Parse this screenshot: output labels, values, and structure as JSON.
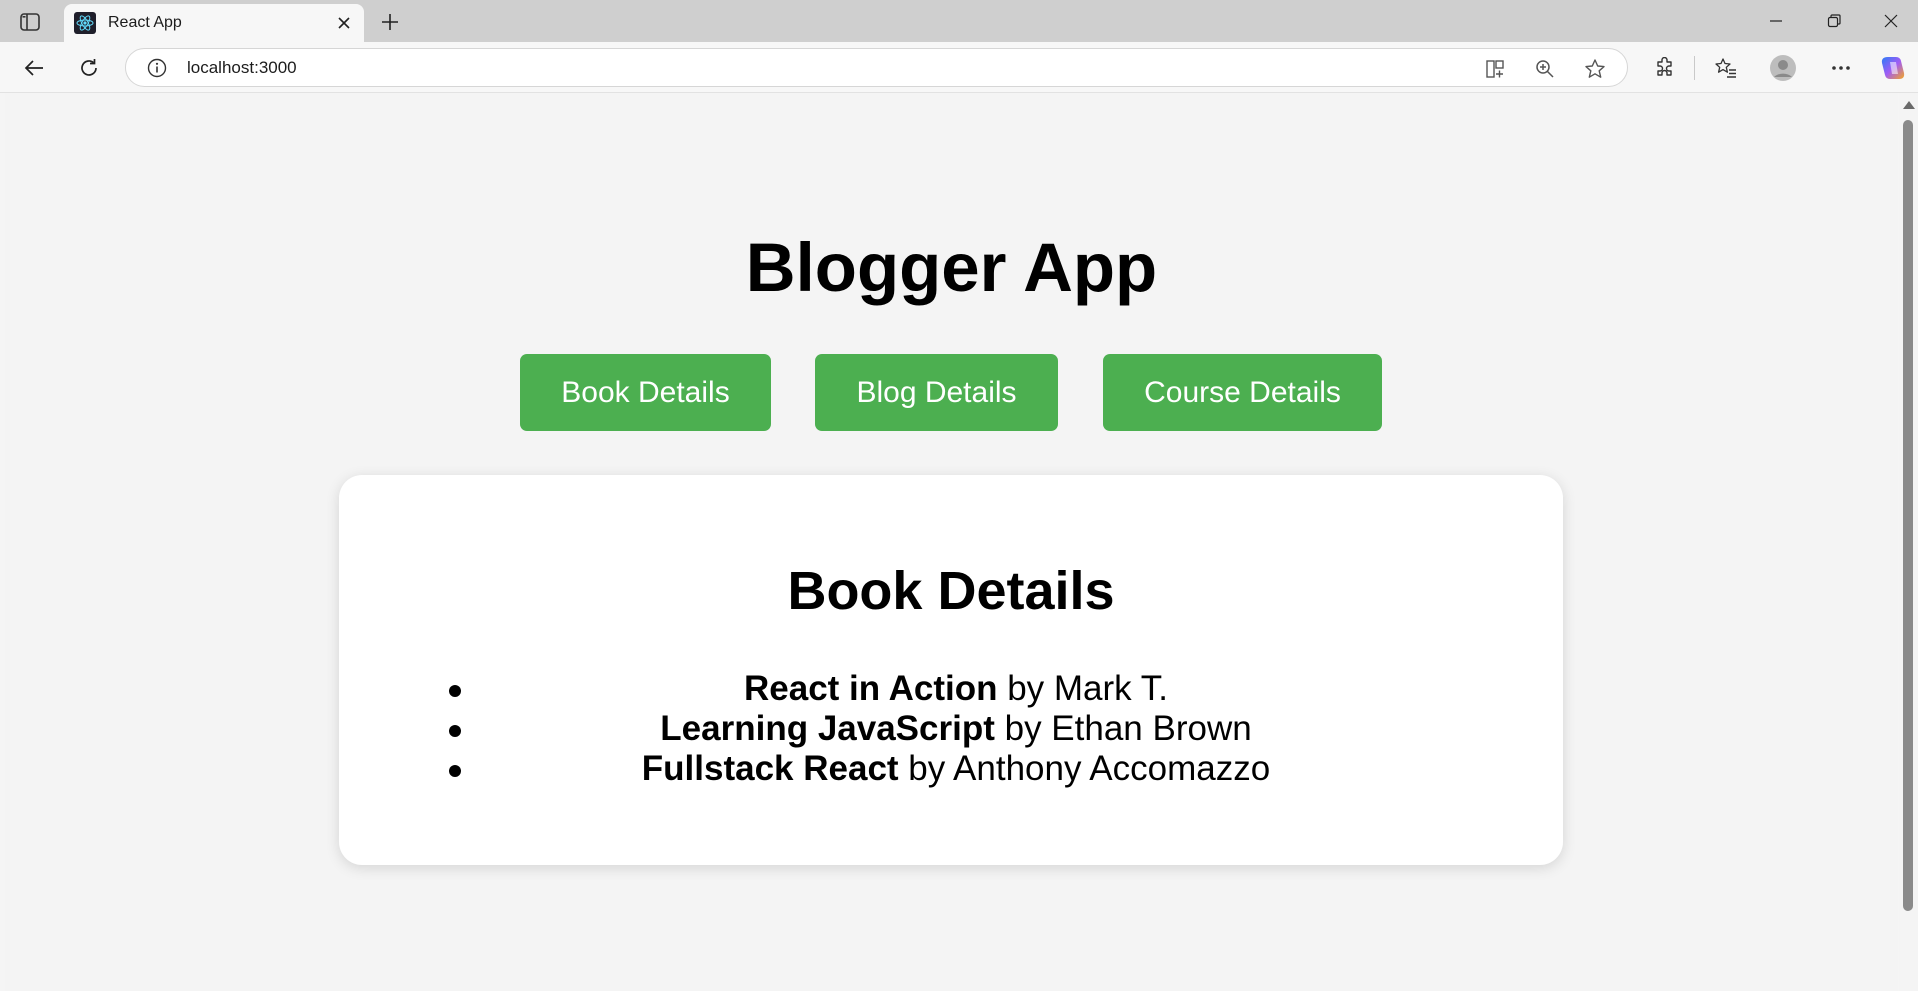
{
  "browser": {
    "tab_title": "React App",
    "url": "localhost:3000"
  },
  "page": {
    "title": "Blogger App",
    "buttons": [
      {
        "label": "Book Details"
      },
      {
        "label": "Blog Details"
      },
      {
        "label": "Course Details"
      }
    ],
    "card": {
      "heading": "Book Details",
      "books": [
        {
          "title": "React in Action",
          "byline": " by Mark T."
        },
        {
          "title": "Learning JavaScript",
          "byline": " by Ethan Brown"
        },
        {
          "title": "Fullstack React",
          "byline": " by Anthony Accomazzo"
        }
      ]
    }
  },
  "colors": {
    "button_bg": "#4caf50",
    "page_bg": "#f4f4f4",
    "card_bg": "#ffffff"
  },
  "icons": [
    "sidebar-toggle-icon",
    "react-favicon-icon",
    "close-icon",
    "plus-icon",
    "minimize-icon",
    "restore-icon",
    "window-close-icon",
    "back-arrow-icon",
    "refresh-icon",
    "info-icon",
    "split-screen-icon",
    "zoom-icon",
    "star-icon",
    "extensions-icon",
    "favorites-icon",
    "profile-icon",
    "more-icon",
    "copilot-icon"
  ]
}
